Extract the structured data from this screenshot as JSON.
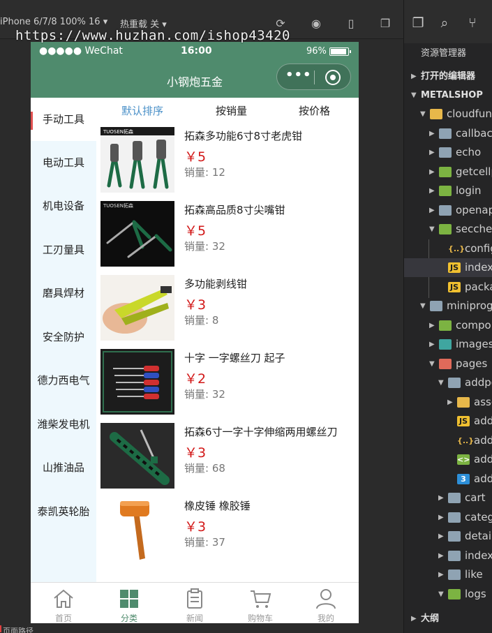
{
  "watermark": "https://www.huzhan.com/ishop43420",
  "ide": {
    "device": "iPhone 6/7/8 100% 16 ▾",
    "reload_mode": "热重载 关 ▾",
    "bottom_label": "页面路径",
    "explorer_title": "资源管理器",
    "outline_title": "大纲",
    "tree": [
      {
        "label": "打开的编辑器",
        "section": true
      },
      {
        "label": "METALSHOP",
        "section": true
      },
      {
        "label": "cloudfun",
        "folder": "yellow"
      },
      {
        "label": "callback",
        "folder": "plain"
      },
      {
        "label": "echo",
        "folder": "plain"
      },
      {
        "label": "getcellp",
        "folder": "green"
      },
      {
        "label": "login",
        "folder": "green"
      },
      {
        "label": "openap",
        "folder": "plain"
      },
      {
        "label": "secchec",
        "folder": "green"
      },
      {
        "label": "config",
        "file": "{..}"
      },
      {
        "label": "index",
        "file": "JS"
      },
      {
        "label": "packa",
        "file": "JS"
      },
      {
        "label": "miniprog",
        "folder": "plain"
      },
      {
        "label": "compo",
        "folder": "green"
      },
      {
        "label": "images",
        "folder": "teal"
      },
      {
        "label": "pages",
        "folder": "red"
      },
      {
        "label": "addpo",
        "folder": "plain"
      },
      {
        "label": "asse",
        "folder": "yellow"
      },
      {
        "label": "addp",
        "file": "JS"
      },
      {
        "label": "addp",
        "file": "{..}"
      },
      {
        "label": "addp",
        "file": "<>"
      },
      {
        "label": "addp",
        "file": "3"
      },
      {
        "label": "cart",
        "folder": "plain"
      },
      {
        "label": "categ",
        "folder": "plain"
      },
      {
        "label": "detail",
        "folder": "plain"
      },
      {
        "label": "index",
        "folder": "plain"
      },
      {
        "label": "like",
        "folder": "plain"
      },
      {
        "label": "logs",
        "folder": "green"
      }
    ]
  },
  "status": {
    "carrier": "●●●●● WeChat",
    "time": "16:00",
    "battery": "96%",
    "battery_level": 0.96
  },
  "nav": {
    "title": "小钢炮五金"
  },
  "categories": [
    "手动工具",
    "电动工具",
    "机电设备",
    "工刃量具",
    "磨具焊材",
    "安全防护",
    "德力西电气",
    "潍柴发电机",
    "山推油品",
    "泰凯英轮胎"
  ],
  "sort_tabs": [
    "默认排序",
    "按销量",
    "按价格"
  ],
  "sales_label": "销量:",
  "products": [
    {
      "name": "拓森多功能6寸8寸老虎钳",
      "price": "￥5",
      "sales": "12"
    },
    {
      "name": "拓森高品质8寸尖嘴钳",
      "price": "￥5",
      "sales": "32"
    },
    {
      "name": "多功能剥线钳",
      "price": "￥3",
      "sales": "8"
    },
    {
      "name": "十字 一字螺丝刀 起子",
      "price": "￥2",
      "sales": "32"
    },
    {
      "name": "拓森6寸一字十字伸缩两用螺丝刀",
      "price": "￥3",
      "sales": "68"
    },
    {
      "name": "橡皮锤 橡胶锤",
      "price": "￥3",
      "sales": "37"
    }
  ],
  "tabbar": [
    {
      "label": "首页",
      "icon": "home-icon"
    },
    {
      "label": "分类",
      "icon": "grid-icon"
    },
    {
      "label": "新闻",
      "icon": "clipboard-icon"
    },
    {
      "label": "购物车",
      "icon": "cart-icon"
    },
    {
      "label": "我的",
      "icon": "user-icon"
    }
  ]
}
